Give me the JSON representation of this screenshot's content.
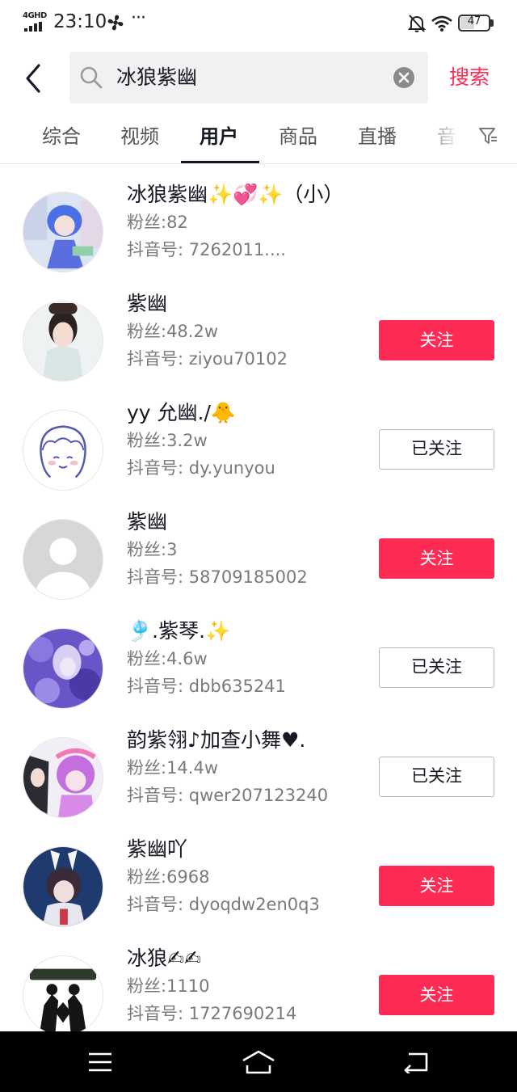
{
  "status_bar": {
    "network": "4GHD",
    "time": "23:10",
    "more": "···",
    "battery": "47"
  },
  "search": {
    "query": "冰狼紫幽",
    "action_label": "搜索"
  },
  "tabs": [
    {
      "label": "综合"
    },
    {
      "label": "视频"
    },
    {
      "label": "用户",
      "active": true
    },
    {
      "label": "商品"
    },
    {
      "label": "直播"
    },
    {
      "label": "音"
    }
  ],
  "users": [
    {
      "name": "冰狼紫幽✨💞✨（小）",
      "fans": "粉丝:82",
      "id": "抖音号: 7262011....",
      "button": ""
    },
    {
      "name": "紫幽",
      "fans": "粉丝:48.2w",
      "id": "抖音号: ziyou70102",
      "button": "关注"
    },
    {
      "name": "yy 允幽./🐥",
      "fans": "粉丝:3.2w",
      "id": "抖音号: dy.yunyou",
      "button": "已关注"
    },
    {
      "name": "紫幽",
      "fans": "粉丝:3",
      "id": "抖音号: 58709185002",
      "button": "关注"
    },
    {
      "name": "🎐.紫琴.✨",
      "fans": "粉丝:4.6w",
      "id": "抖音号: dbb635241",
      "button": "已关注"
    },
    {
      "name": "韵紫翎♪加查小舞♥.",
      "fans": "粉丝:14.4w",
      "id": "抖音号: qwer207123240",
      "button": "已关注"
    },
    {
      "name": "紫幽吖",
      "fans": "粉丝:6968",
      "id": "抖音号: dyoqdw2en0q3",
      "button": "关注"
    },
    {
      "name": "冰狼✍✍",
      "fans": "粉丝:1110",
      "id": "抖音号: 1727690214",
      "button": "关注"
    }
  ],
  "colors": {
    "accent": "#fe2c55",
    "text": "#161823",
    "secondary_text": "#7a7a7a"
  },
  "icons": [
    "signal-icon",
    "fan-icon",
    "mute-bell-icon",
    "wifi-icon",
    "battery-icon",
    "back-arrow-icon",
    "search-icon",
    "clear-icon",
    "filter-icon",
    "menu-icon",
    "home-icon",
    "return-icon"
  ]
}
